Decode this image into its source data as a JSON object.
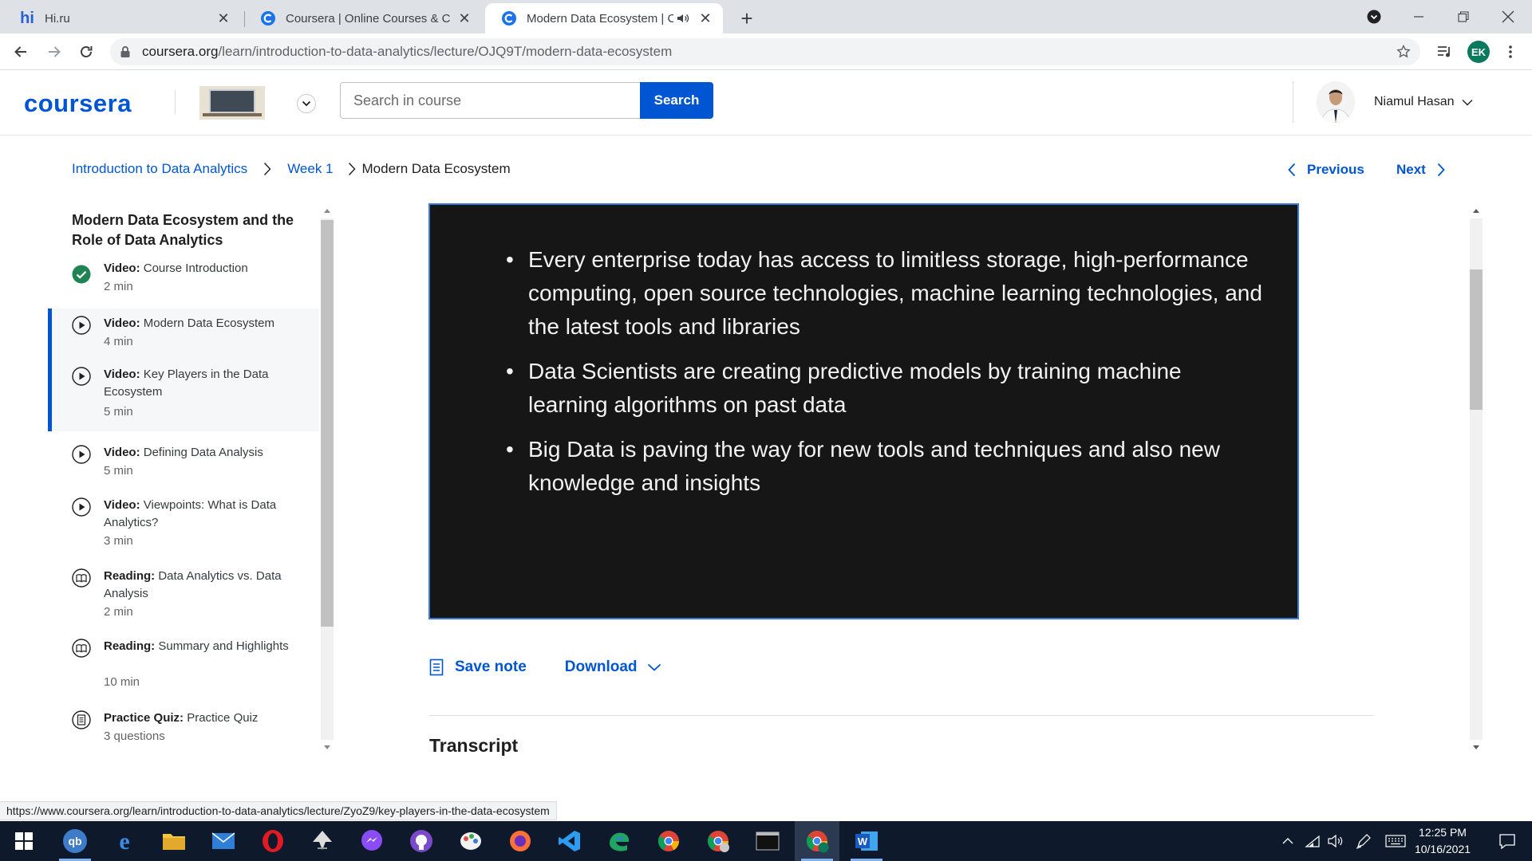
{
  "browser": {
    "tabs": [
      {
        "title": "Hi.ru",
        "favicon": "hi-logo-icon"
      },
      {
        "title": "Coursera | Online Courses & Credentials",
        "favicon": "chrome-page-icon"
      },
      {
        "title": "Modern Data Ecosystem | Coursera",
        "favicon": "chrome-page-icon"
      }
    ],
    "url_host": "coursera.org",
    "url_path": "/learn/introduction-to-data-analytics/lecture/OJQ9T/modern-data-ecosystem",
    "profile_initials": "EK",
    "status_url": "https://www.coursera.org/learn/introduction-to-data-analytics/lecture/ZyoZ9/key-players-in-the-data-ecosystem"
  },
  "header": {
    "logo": "coursera",
    "search_placeholder": "Search in course",
    "search_button": "Search",
    "user_name": "Niamul Hasan"
  },
  "breadcrumb": {
    "course": "Introduction to Data Analytics",
    "week": "Week 1",
    "current": "Modern Data Ecosystem"
  },
  "nav": {
    "previous": "Previous",
    "next": "Next"
  },
  "sidebar": {
    "title": "Modern Data Ecosystem and the Role of Data Analytics",
    "items": [
      {
        "type": "Video:",
        "name": "Course Introduction",
        "meta": "2 min",
        "icon": "check-circle-icon"
      },
      {
        "type": "Video:",
        "name": "Modern Data Ecosystem",
        "meta": "4 min",
        "icon": "play-circle-icon"
      },
      {
        "type": "Video:",
        "name": "Key Players in the Data Ecosystem",
        "meta": "5 min",
        "icon": "play-circle-icon"
      },
      {
        "type": "Video:",
        "name": "Defining Data Analysis",
        "meta": "5 min",
        "icon": "play-circle-icon"
      },
      {
        "type": "Video:",
        "name": "Viewpoints: What is Data Analytics?",
        "meta": "3 min",
        "icon": "play-circle-icon"
      },
      {
        "type": "Reading:",
        "name": "Data Analytics vs. Data Analysis",
        "meta": "2 min",
        "icon": "book-icon"
      },
      {
        "type": "Reading:",
        "name": "Summary and Highlights",
        "meta": "10 min",
        "icon": "book-icon"
      },
      {
        "type": "Practice Quiz:",
        "name": "Practice Quiz",
        "meta": "3 questions",
        "icon": "quiz-icon"
      }
    ]
  },
  "video": {
    "bullets": [
      "Every enterprise today has access to limitless storage, high-performance computing, open source technologies, machine learning technologies, and the latest tools and libraries",
      "Data Scientists are creating predictive models by training machine learning algorithms on past data",
      "Big Data is paving the way for new tools and techniques and also new knowledge and insights"
    ]
  },
  "actions": {
    "save_note": "Save note",
    "download": "Download"
  },
  "transcript_heading": "Transcript",
  "taskbar": {
    "time": "12:25 PM",
    "date": "10/16/2021",
    "apps": [
      "qb-icon",
      "edge-icon",
      "file-explorer-icon",
      "mail-icon",
      "opera-icon",
      "inkscape-icon",
      "messenger-icon",
      "github-icon",
      "paint-icon",
      "firefox-icon",
      "vscode-icon",
      "edge-legacy-icon",
      "chrome-icon",
      "chrome-2-icon",
      "terminal-icon",
      "chrome-ek-icon",
      "word-icon"
    ]
  },
  "colors": {
    "brand": "#0056d2",
    "video_bg": "#161616",
    "taskbar": "#0e1a2b",
    "complete": "#1f8354"
  }
}
